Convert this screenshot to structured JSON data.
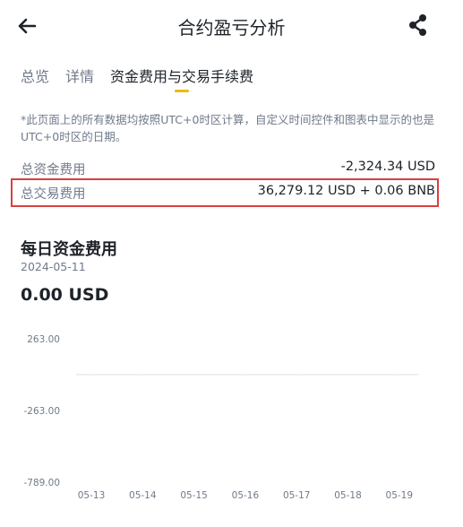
{
  "header": {
    "title": "合约盈亏分析",
    "back_icon": "back-arrow-icon",
    "share_icon": "share-icon"
  },
  "tabs": [
    {
      "label": "总览",
      "active": false
    },
    {
      "label": "详情",
      "active": false
    },
    {
      "label": "资金费用与交易手续费",
      "active": true
    }
  ],
  "note": "*此页面上的所有数据均按照UTC+0时区计算，自定义时间控件和图表中显示的也是UTC+0时区的日期。",
  "summary": {
    "funding_label": "总资金费用",
    "funding_value": "-2,324.34 USD",
    "fees_label": "总交易费用",
    "fees_value": "36,279.12 USD + 0.06 BNB"
  },
  "daily": {
    "title": "每日资金费用",
    "date": "2024-05-11",
    "value": "0.00 USD"
  },
  "colors": {
    "accent": "#f0b90b",
    "highlight_border": "#d9403f",
    "muted_text": "#707a8a"
  },
  "chart_data": {
    "type": "line",
    "categories": [
      "05-13",
      "05-14",
      "05-15",
      "05-16",
      "05-17",
      "05-18",
      "05-19"
    ],
    "series": [
      {
        "values": [
          0,
          0,
          0,
          0,
          0,
          0,
          0
        ]
      }
    ],
    "y_ticks": [
      "263.00",
      "-263.00",
      "-789.00"
    ],
    "y_tick_values": [
      263,
      -263,
      -789
    ],
    "ylim": [
      -789,
      263
    ],
    "grid": false
  }
}
